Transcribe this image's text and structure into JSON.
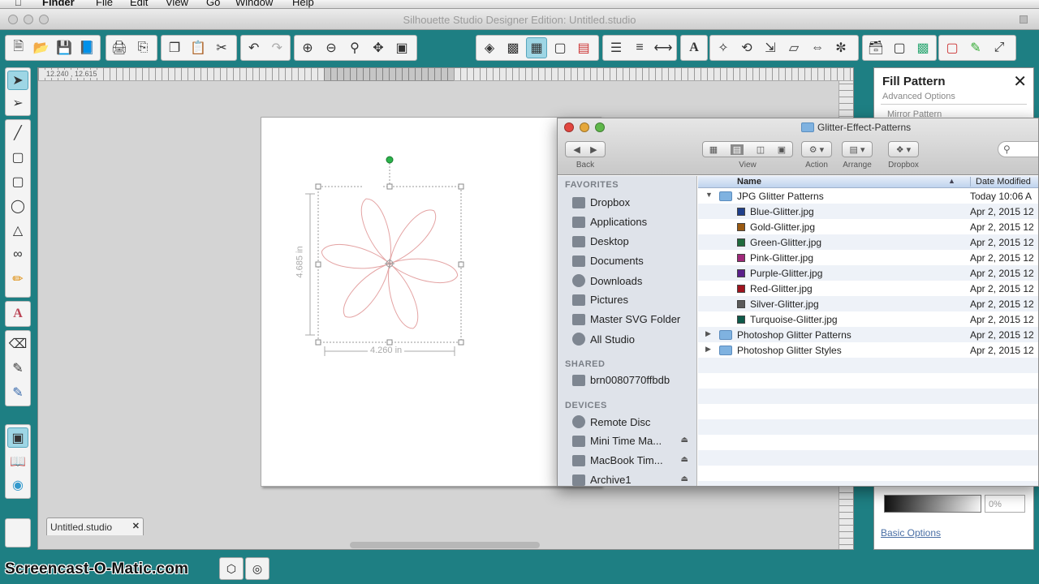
{
  "menubar": {
    "items": [
      "Finder",
      "File",
      "Edit",
      "View",
      "Go",
      "Window",
      "Help"
    ]
  },
  "app": {
    "title": "Silhouette Studio Designer Edition: Untitled.studio",
    "doc_tab": "Untitled.studio",
    "ruler_coord": "12.240 , 12.615"
  },
  "canvas": {
    "width_label": "4.260 in",
    "height_label": "4.685 in"
  },
  "panel": {
    "title": "Fill Pattern",
    "advanced": "Advanced Options",
    "mirror": "Mirror Pattern",
    "percent": "0%",
    "basic_link": "Basic Options"
  },
  "watermark": "Screencast-O-Matic.com",
  "finder": {
    "title": "Glitter-Effect-Patterns",
    "toolbar": {
      "back": "Back",
      "view": "View",
      "action": "Action",
      "arrange": "Arrange",
      "dropbox": "Dropbox"
    },
    "sidebar": {
      "favorites_header": "FAVORITES",
      "favorites": [
        "Dropbox",
        "Applications",
        "Desktop",
        "Documents",
        "Downloads",
        "Pictures",
        "Master SVG Folder",
        "All Studio"
      ],
      "shared_header": "SHARED",
      "shared": [
        "brn0080770ffbdb"
      ],
      "devices_header": "DEVICES",
      "devices": [
        "Remote Disc",
        "Mini Time Ma...",
        "MacBook Tim...",
        "Archive1"
      ]
    },
    "columns": {
      "name": "Name",
      "date": "Date Modified"
    },
    "rows": [
      {
        "name": "JPG Glitter Patterns",
        "date": "Today 10:06 A",
        "kind": "folder-open",
        "color": "#7fb2e0"
      },
      {
        "name": "Blue-Glitter.jpg",
        "date": "Apr 2, 2015 12",
        "kind": "file",
        "color": "#1f3f8a"
      },
      {
        "name": "Gold-Glitter.jpg",
        "date": "Apr 2, 2015 12",
        "kind": "file",
        "color": "#9a5a12"
      },
      {
        "name": "Green-Glitter.jpg",
        "date": "Apr 2, 2015 12",
        "kind": "file",
        "color": "#1f6a3c"
      },
      {
        "name": "Pink-Glitter.jpg",
        "date": "Apr 2, 2015 12",
        "kind": "file",
        "color": "#a0287a"
      },
      {
        "name": "Purple-Glitter.jpg",
        "date": "Apr 2, 2015 12",
        "kind": "file",
        "color": "#5a1f8a"
      },
      {
        "name": "Red-Glitter.jpg",
        "date": "Apr 2, 2015 12",
        "kind": "file",
        "color": "#a0141e"
      },
      {
        "name": "Silver-Glitter.jpg",
        "date": "Apr 2, 2015 12",
        "kind": "file",
        "color": "#5a5a5a"
      },
      {
        "name": "Turquoise-Glitter.jpg",
        "date": "Apr 2, 2015 12",
        "kind": "file",
        "color": "#0e5a4a"
      },
      {
        "name": "Photoshop Glitter Patterns",
        "date": "Apr 2, 2015 12",
        "kind": "folder",
        "color": "#7fb2e0"
      },
      {
        "name": "Photoshop Glitter Styles",
        "date": "Apr 2, 2015 12",
        "kind": "folder",
        "color": "#7fb2e0"
      }
    ]
  },
  "colors": {
    "app_bg": "#1e7f83",
    "selection_blue": "#9ed6e5",
    "shape_stroke": "#e4a3a3"
  }
}
